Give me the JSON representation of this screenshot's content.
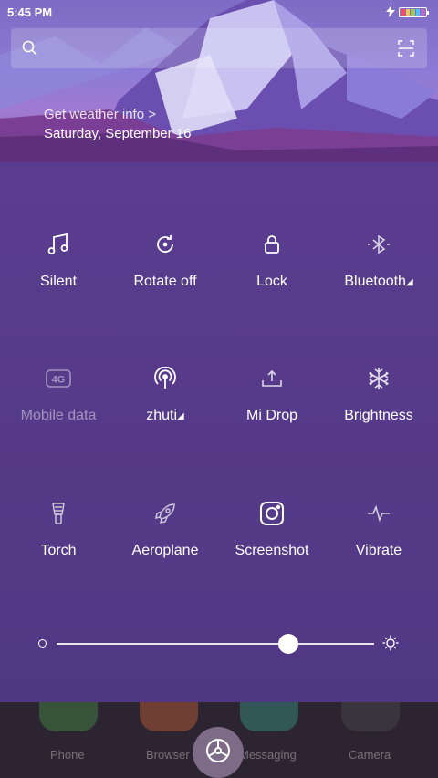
{
  "status_bar": {
    "time": "5:45 PM",
    "charging_icon": "bolt-icon",
    "battery_colors": [
      "#f04f6a",
      "#f7c843",
      "#9ccc65",
      "#4fc3f7",
      "#ba68c8"
    ]
  },
  "header": {
    "search_icon": "search-icon",
    "scan_icon": "scan-icon",
    "weather_link": "Get weather info >",
    "date": "Saturday, September 16"
  },
  "toggles": [
    {
      "label": "Silent",
      "icon": "music-note-icon",
      "active": true
    },
    {
      "label": "Rotate off",
      "icon": "rotate-icon",
      "active": true
    },
    {
      "label": "Lock",
      "icon": "lock-icon",
      "active": true
    },
    {
      "label": "Bluetooth",
      "icon": "bluetooth-icon",
      "active": true,
      "has_menu": true
    },
    {
      "label": "Mobile data",
      "icon": "4g-icon",
      "active": false
    },
    {
      "label": "zhuti",
      "icon": "hotspot-icon",
      "active": true,
      "has_menu": true
    },
    {
      "label": "Mi Drop",
      "icon": "upload-icon",
      "active": true
    },
    {
      "label": "Brightness",
      "icon": "snowflake-icon",
      "active": true
    },
    {
      "label": "Torch",
      "icon": "torch-icon",
      "active": true
    },
    {
      "label": "Aeroplane",
      "icon": "rocket-icon",
      "active": true
    },
    {
      "label": "Screenshot",
      "icon": "camera-icon",
      "active": true
    },
    {
      "label": "Vibrate",
      "icon": "pulse-icon",
      "active": true
    }
  ],
  "brightness_slider": {
    "value": 0.73
  },
  "dock": {
    "apps": [
      {
        "label": "Phone",
        "color": "#4caf50"
      },
      {
        "label": "Browser",
        "color": "#f0733a"
      },
      {
        "label": "Messaging",
        "color": "#3cb9a0"
      },
      {
        "label": "Camera",
        "color": "#555555"
      }
    ],
    "settings_icon": "settings-icon"
  },
  "colors": {
    "panel": "#5a3d8f",
    "accent": "#ffffff"
  }
}
